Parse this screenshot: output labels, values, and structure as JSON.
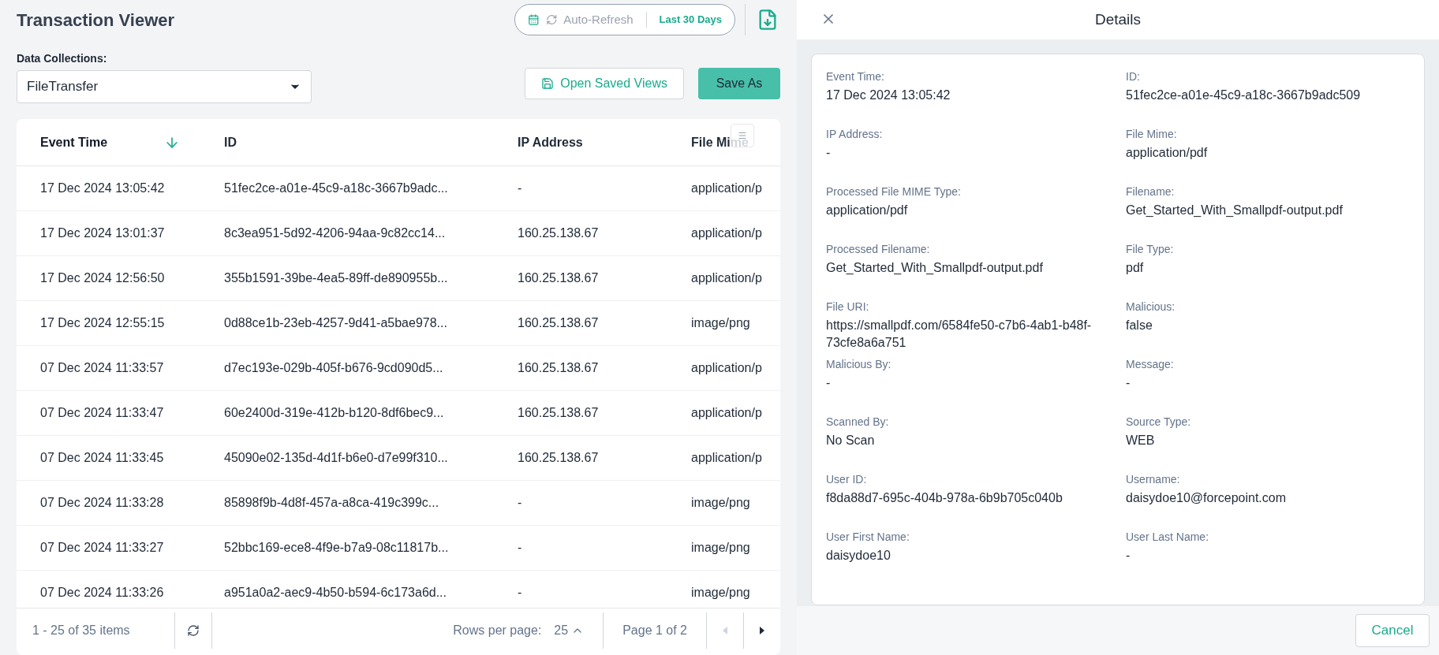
{
  "header": {
    "title": "Transaction Viewer",
    "auto_refresh": {
      "label": "Auto-Refresh",
      "on": false
    },
    "date_range": "Last 30 Days"
  },
  "data_collections": {
    "label": "Data Collections:",
    "value": "FileTransfer"
  },
  "buttons": {
    "open_saved_views": "Open Saved Views",
    "save_as": "Save As"
  },
  "table": {
    "columns": [
      {
        "label": "Event Time",
        "sorted": true
      },
      {
        "label": "ID",
        "sorted": false
      },
      {
        "label": "IP Address",
        "sorted": false
      },
      {
        "label": "File Mime",
        "sorted": false
      }
    ],
    "rows": [
      [
        "17 Dec 2024 13:05:42",
        "51fec2ce-a01e-45c9-a18c-3667b9adc...",
        "-",
        "application/p"
      ],
      [
        "17 Dec 2024 13:01:37",
        "8c3ea951-5d92-4206-94aa-9c82cc14...",
        "160.25.138.67",
        "application/p"
      ],
      [
        "17 Dec 2024 12:56:50",
        "355b1591-39be-4ea5-89ff-de890955b...",
        "160.25.138.67",
        "application/p"
      ],
      [
        "17 Dec 2024 12:55:15",
        "0d88ce1b-23eb-4257-9d41-a5bae978...",
        "160.25.138.67",
        "image/png"
      ],
      [
        "07 Dec 2024 11:33:57",
        "d7ec193e-029b-405f-b676-9cd090d5...",
        "160.25.138.67",
        "application/p"
      ],
      [
        "07 Dec 2024 11:33:47",
        "60e2400d-319e-412b-b120-8df6bec9...",
        "160.25.138.67",
        "application/p"
      ],
      [
        "07 Dec 2024 11:33:45",
        "45090e02-135d-4d1f-b6e0-d7e99f310...",
        "160.25.138.67",
        "application/p"
      ],
      [
        "07 Dec 2024 11:33:28",
        "85898f9b-4d8f-457a-a8ca-419c399c...",
        "-",
        "image/png"
      ],
      [
        "07 Dec 2024 11:33:27",
        "52bbc169-ece8-4f9e-b7a9-08c11817b...",
        "-",
        "image/png"
      ],
      [
        "07 Dec 2024 11:33:26",
        "a951a0a2-aec9-4b50-b594-6c173a6d...",
        "-",
        "image/png"
      ]
    ]
  },
  "pagination": {
    "summary": "1 - 25 of 35 items",
    "rows_per_page_label": "Rows per page:",
    "rows_per_page": "25",
    "page": "Page 1 of 2",
    "prev_disabled": true,
    "next_disabled": false
  },
  "details": {
    "title": "Details",
    "fields": [
      {
        "label": "Event Time:",
        "value": "17 Dec 2024 13:05:42"
      },
      {
        "label": "ID:",
        "value": "51fec2ce-a01e-45c9-a18c-3667b9adc509"
      },
      {
        "label": "IP Address:",
        "value": "-"
      },
      {
        "label": "File Mime:",
        "value": "application/pdf"
      },
      {
        "label": "Processed File MIME Type:",
        "value": "application/pdf"
      },
      {
        "label": "Filename:",
        "value": "Get_Started_With_Smallpdf-output.pdf"
      },
      {
        "label": "Processed Filename:",
        "value": "Get_Started_With_Smallpdf-output.pdf"
      },
      {
        "label": "File Type:",
        "value": "pdf"
      },
      {
        "label": "File URI:",
        "value": "https://smallpdf.com/6584fe50-c7b6-4ab1-b48f-73cfe8a6a751"
      },
      {
        "label": "Malicious:",
        "value": "false"
      },
      {
        "label": "Malicious By:",
        "value": "-"
      },
      {
        "label": "Message:",
        "value": "-"
      },
      {
        "label": "Scanned By:",
        "value": "No Scan"
      },
      {
        "label": "Source Type:",
        "value": "WEB"
      },
      {
        "label": "User ID:",
        "value": "f8da88d7-695c-404b-978a-6b9b705c040b"
      },
      {
        "label": "Username:",
        "value": "daisydoe10@forcepoint.com"
      },
      {
        "label": "User First Name:",
        "value": "daisydoe10"
      },
      {
        "label": "User Last Name:",
        "value": "-"
      }
    ],
    "cancel": "Cancel"
  }
}
